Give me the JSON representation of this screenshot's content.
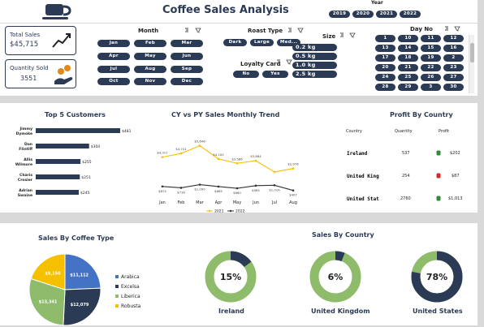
{
  "header": {
    "title": "Coffee Sales Analysis",
    "year_label": "Year",
    "years": [
      "2019",
      "2020",
      "2021",
      "2022"
    ]
  },
  "kpis": {
    "total_sales_label": "Total Sales",
    "total_sales_value": "$45,715",
    "quantity_label": "Quantity Sold",
    "quantity_value": "3551"
  },
  "slicers": {
    "month": {
      "title": "Month",
      "items": [
        "Jan",
        "Feb",
        "Mar",
        "Apr",
        "May",
        "Jun",
        "Jul",
        "Aug",
        "Sep",
        "Oct",
        "Nov",
        "Dec"
      ]
    },
    "roast": {
      "title": "Roast Type",
      "items": [
        "Dark",
        "Large",
        "Med..."
      ]
    },
    "loyalty": {
      "title": "Loyalty Card",
      "items": [
        "No",
        "Yes"
      ]
    },
    "size": {
      "title": "Size",
      "items": [
        "0.2 kg",
        "0.5 kg",
        "1.0 kg",
        "2.5 kg"
      ]
    },
    "day": {
      "title": "Day No",
      "items": [
        "1",
        "10",
        "11",
        "12",
        "13",
        "14",
        "15",
        "16",
        "17",
        "18",
        "19",
        "2",
        "20",
        "21",
        "22",
        "23",
        "24",
        "25",
        "26",
        "27",
        "28",
        "29",
        "3",
        "30"
      ]
    }
  },
  "top_customers": {
    "title": "Top 5 Customers",
    "chart_data": {
      "type": "bar",
      "categories": [
        "Jimmy Dymoke",
        "Don Flintiff",
        "Allis Wilmore",
        "Charis Crosier",
        "Adrian Swaine"
      ],
      "values": [
        481,
        304,
        255,
        251,
        245
      ],
      "labels": [
        "$481",
        "$304",
        "$255",
        "$251",
        "$245"
      ],
      "color": "#2b3a55"
    }
  },
  "trend": {
    "title": "CY vs PY Sales Monthly Trend",
    "chart_data": {
      "type": "line",
      "categories": [
        "Jan",
        "Feb",
        "Mar",
        "Apr",
        "May",
        "Jun",
        "Jul",
        "Aug"
      ],
      "series": [
        {
          "name": "2021",
          "values": [
            4311,
            4741,
            5646,
            4100,
            3586,
            3884,
            2570,
            2976
          ],
          "labels": [
            "$4,311",
            "$4,741",
            "$5,646",
            "$4,100",
            "$3,586",
            "$3,884",
            "",
            "$2,976"
          ],
          "color": "#f5c000"
        },
        {
          "name": "2022",
          "values": [
            874,
            716,
            1090,
            865,
            660,
            965,
            1016,
            407
          ],
          "labels": [
            "$874",
            "$716",
            "$1,090",
            "$865",
            "$660",
            "$965",
            "$1,016",
            "$407"
          ],
          "color": "#333333"
        }
      ]
    }
  },
  "profit_country": {
    "title": "Profit By Country",
    "headers": [
      "Country",
      "Quantity",
      "Profit"
    ],
    "rows": [
      {
        "country": "Ireland",
        "quantity": "537",
        "profit": "$202",
        "icon_color": "#2e8b3a"
      },
      {
        "country": "United King",
        "quantity": "254",
        "profit": "$87",
        "icon_color": "#d62a2a"
      },
      {
        "country": "United Stat",
        "quantity": "2760",
        "profit": "$1,013",
        "icon_color": "#2e8b3a"
      }
    ]
  },
  "coffee_type": {
    "title": "Sales By Coffee Type",
    "chart_data": {
      "type": "pie",
      "categories": [
        "Arabica",
        "Excelsa",
        "Liberica",
        "Robusta"
      ],
      "values": [
        11112,
        12079,
        13341,
        9150
      ],
      "labels": [
        "$11,112",
        "$12,079",
        "$13,341",
        "$9,150"
      ],
      "colors": [
        "#4472c4",
        "#2b3a55",
        "#8fbc6a",
        "#f5c000"
      ]
    }
  },
  "sales_country": {
    "title": "Sales By Country",
    "donuts": [
      {
        "name": "Ireland",
        "percent": 15,
        "label": "15%"
      },
      {
        "name": "United Kingdom",
        "percent": 6,
        "label": "6%"
      },
      {
        "name": "United States",
        "percent": 78,
        "label": "78%"
      }
    ],
    "colors": {
      "main": "#8fbc6a",
      "accent": "#2b3a55"
    }
  }
}
